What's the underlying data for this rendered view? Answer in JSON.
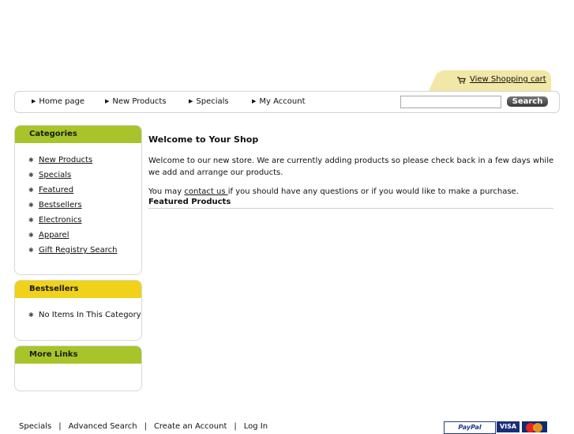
{
  "cart": {
    "icon": "shopping-cart-icon",
    "link": "View Shopping cart"
  },
  "nav": {
    "items": [
      {
        "label": "Home page"
      },
      {
        "label": "New Products"
      },
      {
        "label": "Specials"
      },
      {
        "label": "My Account"
      }
    ],
    "search_placeholder": "",
    "search_button": "Search"
  },
  "sidebar": {
    "categories": {
      "title": "Categories",
      "items": [
        "New Products",
        "Specials",
        "Featured",
        "Bestsellers",
        "Electronics",
        "Apparel",
        "Gift Registry Search"
      ]
    },
    "bestsellers": {
      "title": "Bestsellers",
      "items": [
        "No Items In This Category"
      ]
    },
    "more_links": {
      "title": "More Links"
    }
  },
  "main": {
    "heading": "Welcome to Your Shop",
    "intro": "Welcome to our new store. We are currently adding products so please check back in a few days while we add and arrange our products.",
    "contact_prefix": "You may ",
    "contact_link": "contact us ",
    "contact_suffix": "if you should have any questions or if you would like to make a purchase.",
    "featured_title": "Featured Products"
  },
  "footer": {
    "links": [
      "Specials",
      "Advanced Search",
      "Create an Account",
      "Log In"
    ],
    "separator": "|",
    "payments": {
      "paypal": "PayPal",
      "visa": "VISA",
      "mastercard_icon": "mastercard-icon"
    }
  },
  "colors": {
    "green": "#a7c42a",
    "yellow": "#f0d21a",
    "cart_tab": "#f1e7a6"
  }
}
